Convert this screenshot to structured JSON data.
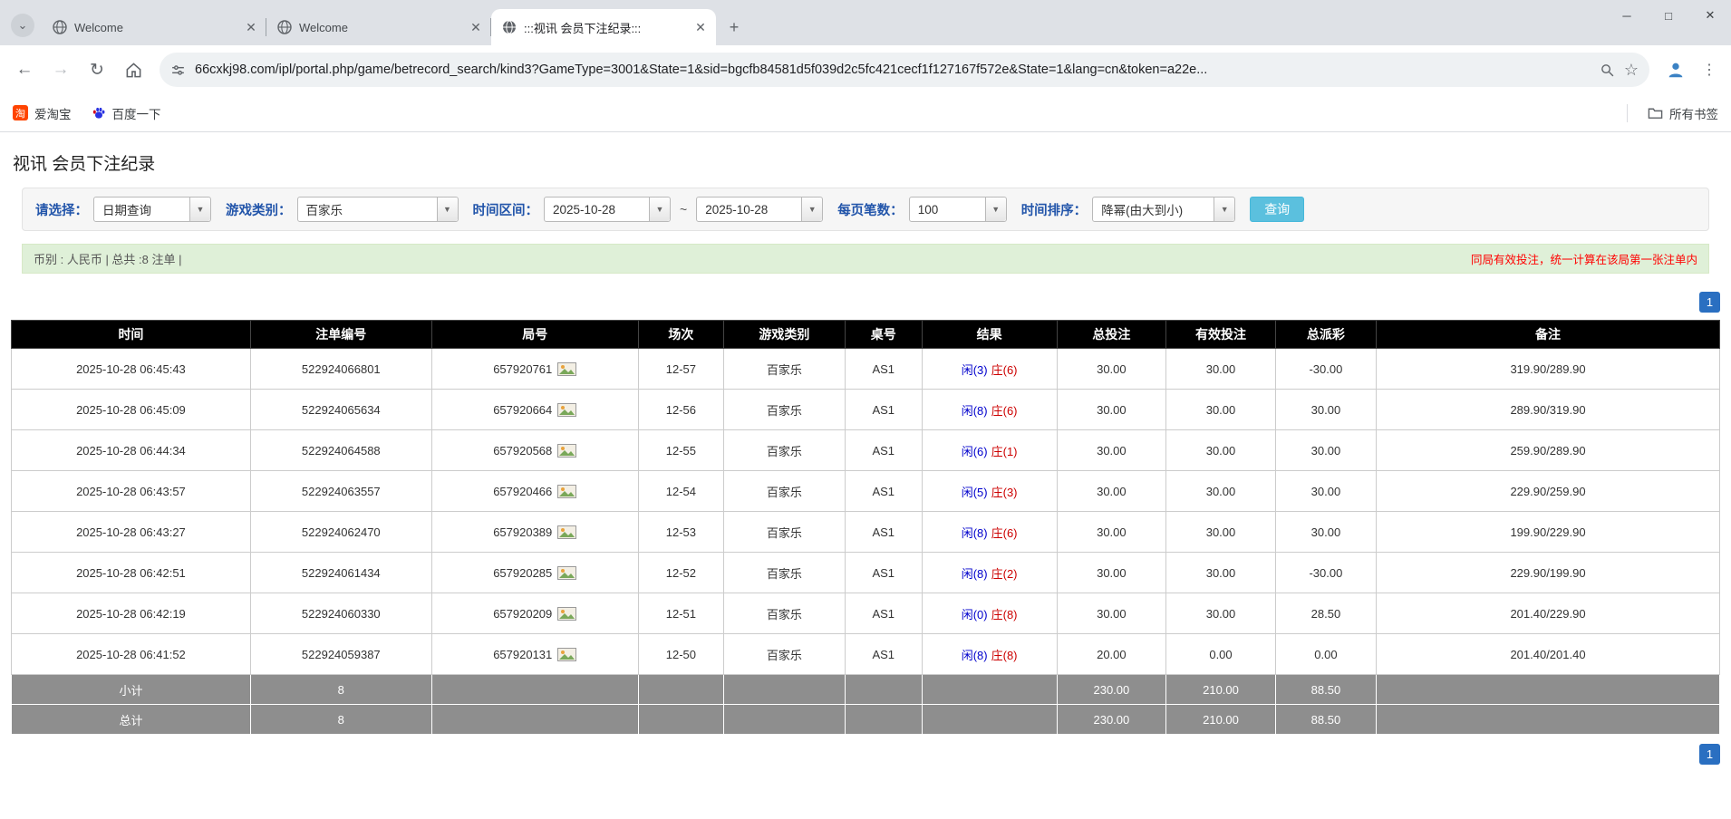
{
  "colors": {
    "accent_blue": "#2a6fc1",
    "player_blue": "#0000cc",
    "banker_red": "#cc0000",
    "negative_red": "#ff0000",
    "query_button": "#5bc0de",
    "summary_bg": "#dff0d8",
    "header_bg": "#000000",
    "footer_bg": "#8e8e8e"
  },
  "browser": {
    "tabs": [
      {
        "title": "Welcome"
      },
      {
        "title": "Welcome"
      },
      {
        "title": ":::视讯 会员下注纪录:::"
      }
    ],
    "active_tab_index": 2,
    "url": "66cxkj98.com/ipl/portal.php/game/betrecord_search/kind3?GameType=3001&State=1&sid=bgcfb84581d5f039d2c5fc421cecf1f127167f572e&State=1&lang=cn&token=a22e...",
    "bookmarks": [
      {
        "label": "爱淘宝",
        "icon": "taobao-icon",
        "brand_color": "#ff4400"
      },
      {
        "label": "百度一下",
        "icon": "baidu-paw-icon",
        "brand_color": "#2932e1"
      }
    ],
    "all_bookmarks_label": "所有书签"
  },
  "page": {
    "title": "视讯 会员下注纪录",
    "filters": {
      "select": {
        "label": "请选择：",
        "value": "日期查询"
      },
      "game_type": {
        "label": "游戏类别：",
        "value": "百家乐"
      },
      "date_range": {
        "label": "时间区间：",
        "from": "2025-10-28",
        "separator": "~",
        "to": "2025-10-28"
      },
      "page_size": {
        "label": "每页笔数：",
        "value": "100"
      },
      "sort": {
        "label": "时间排序：",
        "value": "降幂(由大到小)"
      },
      "query_button": "查询"
    },
    "summary": {
      "currency_info": "币别 : 人民币 | 总共 :8 注单 |",
      "note": "同局有效投注，统一计算在该局第一张注单内"
    },
    "pagination": {
      "page": "1"
    },
    "table": {
      "headers": [
        "时间",
        "注单编号",
        "局号",
        "场次",
        "游戏类别",
        "桌号",
        "结果",
        "总投注",
        "有效投注",
        "总派彩",
        "备注"
      ],
      "rows": [
        {
          "time": "2025-10-28 06:45:43",
          "bet_no": "522924066801",
          "round_no": "657920761",
          "session": "12-57",
          "game": "百家乐",
          "table_no": "AS1",
          "result_player": "闲(3)",
          "result_banker": "庄(6)",
          "total_bet": "30.00",
          "valid_bet": "30.00",
          "payout": "-30.00",
          "note": "319.90/289.90"
        },
        {
          "time": "2025-10-28 06:45:09",
          "bet_no": "522924065634",
          "round_no": "657920664",
          "session": "12-56",
          "game": "百家乐",
          "table_no": "AS1",
          "result_player": "闲(8)",
          "result_banker": "庄(6)",
          "total_bet": "30.00",
          "valid_bet": "30.00",
          "payout": "30.00",
          "note": "289.90/319.90"
        },
        {
          "time": "2025-10-28 06:44:34",
          "bet_no": "522924064588",
          "round_no": "657920568",
          "session": "12-55",
          "game": "百家乐",
          "table_no": "AS1",
          "result_player": "闲(6)",
          "result_banker": "庄(1)",
          "total_bet": "30.00",
          "valid_bet": "30.00",
          "payout": "30.00",
          "note": "259.90/289.90"
        },
        {
          "time": "2025-10-28 06:43:57",
          "bet_no": "522924063557",
          "round_no": "657920466",
          "session": "12-54",
          "game": "百家乐",
          "table_no": "AS1",
          "result_player": "闲(5)",
          "result_banker": "庄(3)",
          "total_bet": "30.00",
          "valid_bet": "30.00",
          "payout": "30.00",
          "note": "229.90/259.90"
        },
        {
          "time": "2025-10-28 06:43:27",
          "bet_no": "522924062470",
          "round_no": "657920389",
          "session": "12-53",
          "game": "百家乐",
          "table_no": "AS1",
          "result_player": "闲(8)",
          "result_banker": "庄(6)",
          "total_bet": "30.00",
          "valid_bet": "30.00",
          "payout": "30.00",
          "note": "199.90/229.90"
        },
        {
          "time": "2025-10-28 06:42:51",
          "bet_no": "522924061434",
          "round_no": "657920285",
          "session": "12-52",
          "game": "百家乐",
          "table_no": "AS1",
          "result_player": "闲(8)",
          "result_banker": "庄(2)",
          "total_bet": "30.00",
          "valid_bet": "30.00",
          "payout": "-30.00",
          "note": "229.90/199.90"
        },
        {
          "time": "2025-10-28 06:42:19",
          "bet_no": "522924060330",
          "round_no": "657920209",
          "session": "12-51",
          "game": "百家乐",
          "table_no": "AS1",
          "result_player": "闲(0)",
          "result_banker": "庄(8)",
          "total_bet": "30.00",
          "valid_bet": "30.00",
          "payout": "28.50",
          "note": "201.40/229.90"
        },
        {
          "time": "2025-10-28 06:41:52",
          "bet_no": "522924059387",
          "round_no": "657920131",
          "session": "12-50",
          "game": "百家乐",
          "table_no": "AS1",
          "result_player": "闲(8)",
          "result_banker": "庄(8)",
          "total_bet": "20.00",
          "valid_bet": "0.00",
          "payout": "0.00",
          "note": "201.40/201.40"
        }
      ],
      "subtotal": {
        "label": "小计",
        "count": "8",
        "total_bet": "230.00",
        "valid_bet": "210.00",
        "payout": "88.50"
      },
      "total": {
        "label": "总计",
        "count": "8",
        "total_bet": "230.00",
        "valid_bet": "210.00",
        "payout": "88.50"
      }
    }
  }
}
